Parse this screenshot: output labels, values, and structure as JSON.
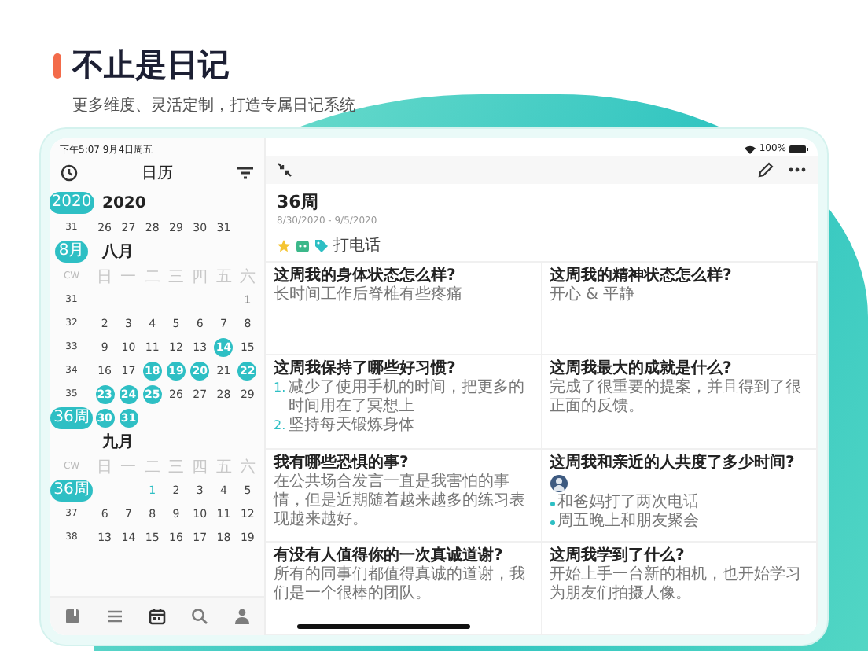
{
  "hero": {
    "title": "不止是日记",
    "subtitle": "更多维度、灵活定制，打造专属日记系统"
  },
  "sidebar": {
    "status": "下午5:07  9月4日周五",
    "title": "日历",
    "year": {
      "badge": "2020",
      "label": "2020",
      "weeks": [
        {
          "week": "31",
          "days": [
            {
              "d": "26",
              "selected": false
            },
            {
              "d": "27",
              "selected": false
            },
            {
              "d": "28",
              "selected": false
            },
            {
              "d": "29",
              "selected": false
            },
            {
              "d": "30",
              "selected": false
            },
            {
              "d": "31",
              "selected": false
            }
          ]
        }
      ]
    },
    "months": [
      {
        "badge": "8月",
        "name": "八月",
        "cw": "CW",
        "weekdays": [
          "日",
          "一",
          "二",
          "三",
          "四",
          "五",
          "六"
        ],
        "weeks": [
          {
            "week": "31",
            "badge": false,
            "days": [
              {
                "d": "1",
                "selected": false
              }
            ]
          },
          {
            "week": "32",
            "badge": false,
            "days": [
              {
                "d": "2",
                "selected": false
              },
              {
                "d": "3",
                "selected": false
              },
              {
                "d": "4",
                "selected": false
              },
              {
                "d": "5",
                "selected": false
              },
              {
                "d": "6",
                "selected": false
              },
              {
                "d": "7",
                "selected": false
              },
              {
                "d": "8",
                "selected": false
              }
            ]
          },
          {
            "week": "33",
            "badge": false,
            "days": [
              {
                "d": "9",
                "selected": false
              },
              {
                "d": "10",
                "selected": false
              },
              {
                "d": "11",
                "selected": false
              },
              {
                "d": "12",
                "selected": false
              },
              {
                "d": "13",
                "selected": false
              },
              {
                "d": "14",
                "selected": true
              },
              {
                "d": "15",
                "selected": false
              }
            ]
          },
          {
            "week": "34",
            "badge": false,
            "days": [
              {
                "d": "16",
                "selected": false
              },
              {
                "d": "17",
                "selected": false
              },
              {
                "d": "18",
                "selected": true
              },
              {
                "d": "19",
                "selected": true
              },
              {
                "d": "20",
                "selected": true
              },
              {
                "d": "21",
                "selected": false
              },
              {
                "d": "22",
                "selected": true
              }
            ]
          },
          {
            "week": "35",
            "badge": false,
            "days": [
              {
                "d": "23",
                "selected": true
              },
              {
                "d": "24",
                "selected": true
              },
              {
                "d": "25",
                "selected": true
              },
              {
                "d": "26",
                "selected": false
              },
              {
                "d": "27",
                "selected": false
              },
              {
                "d": "28",
                "selected": false
              },
              {
                "d": "29",
                "selected": false
              }
            ]
          },
          {
            "week": "36周",
            "badge": true,
            "days": [
              {
                "d": "30",
                "selected": true
              },
              {
                "d": "31",
                "selected": true
              }
            ]
          }
        ]
      },
      {
        "name": "九月",
        "cw": "CW",
        "weekdays": [
          "日",
          "一",
          "二",
          "三",
          "四",
          "五",
          "六"
        ],
        "weeks": [
          {
            "week": "36周",
            "badge": true,
            "days": [
              {
                "d": "1",
                "selected": false,
                "today": true
              },
              {
                "d": "2",
                "selected": false
              },
              {
                "d": "3",
                "selected": false
              },
              {
                "d": "4",
                "selected": false
              },
              {
                "d": "5",
                "selected": false
              }
            ]
          },
          {
            "week": "37",
            "badge": false,
            "days": [
              {
                "d": "6",
                "selected": false
              },
              {
                "d": "7",
                "selected": false
              },
              {
                "d": "8",
                "selected": false
              },
              {
                "d": "9",
                "selected": false
              },
              {
                "d": "10",
                "selected": false
              },
              {
                "d": "11",
                "selected": false
              },
              {
                "d": "12",
                "selected": false
              }
            ]
          },
          {
            "week": "38",
            "badge": false,
            "days": [
              {
                "d": "13",
                "selected": false
              },
              {
                "d": "14",
                "selected": false
              },
              {
                "d": "15",
                "selected": false
              },
              {
                "d": "16",
                "selected": false
              },
              {
                "d": "17",
                "selected": false
              },
              {
                "d": "18",
                "selected": false
              },
              {
                "d": "19",
                "selected": false
              }
            ]
          }
        ]
      }
    ],
    "tabs": [
      {
        "kind": "book",
        "selected": false
      },
      {
        "kind": "list",
        "selected": false
      },
      {
        "kind": "calendar",
        "selected": true
      },
      {
        "kind": "search",
        "selected": false
      },
      {
        "kind": "person",
        "selected": false
      }
    ]
  },
  "detail": {
    "battery": "100%",
    "title": "36周",
    "range": "8/30/2020 - 9/5/2020",
    "tag": "打电话",
    "cards": [
      {
        "kind": "text",
        "question": "这周我的身体状态怎么样?",
        "answer": "长时间工作后脊椎有些疼痛"
      },
      {
        "kind": "text",
        "question": "这周我的精神状态怎么样?",
        "answer": "开心 & 平静"
      },
      {
        "kind": "numbered",
        "question": "这周我保持了哪些好习惯?",
        "items": [
          {
            "n": "1.",
            "text": "减少了使用手机的时间，把更多的时间用在了冥想上"
          },
          {
            "n": "2.",
            "text": "坚持每天锻炼身体"
          }
        ]
      },
      {
        "kind": "text",
        "question": "这周我最大的成就是什么?",
        "answer": "完成了很重要的提案，并且得到了很正面的反馈。"
      },
      {
        "kind": "text",
        "question": "我有哪些恐惧的事?",
        "answer": "在公共场合发言一直是我害怕的事情，但是近期随着越来越多的练习表现越来越好。"
      },
      {
        "kind": "bulleted",
        "question": "这周我和亲近的人共度了多少时间?",
        "items": [
          {
            "text": "和爸妈打了两次电话"
          },
          {
            "text": "周五晚上和朋友聚会"
          }
        ]
      },
      {
        "kind": "text",
        "question": "有没有人值得你的一次真诚道谢?",
        "answer": "所有的同事们都值得真诚的道谢，我们是一个很棒的团队。"
      },
      {
        "kind": "text",
        "question": "这周我学到了什么?",
        "answer": "开始上手一台新的相机，也开始学习为朋友们拍摄人像。"
      }
    ]
  }
}
